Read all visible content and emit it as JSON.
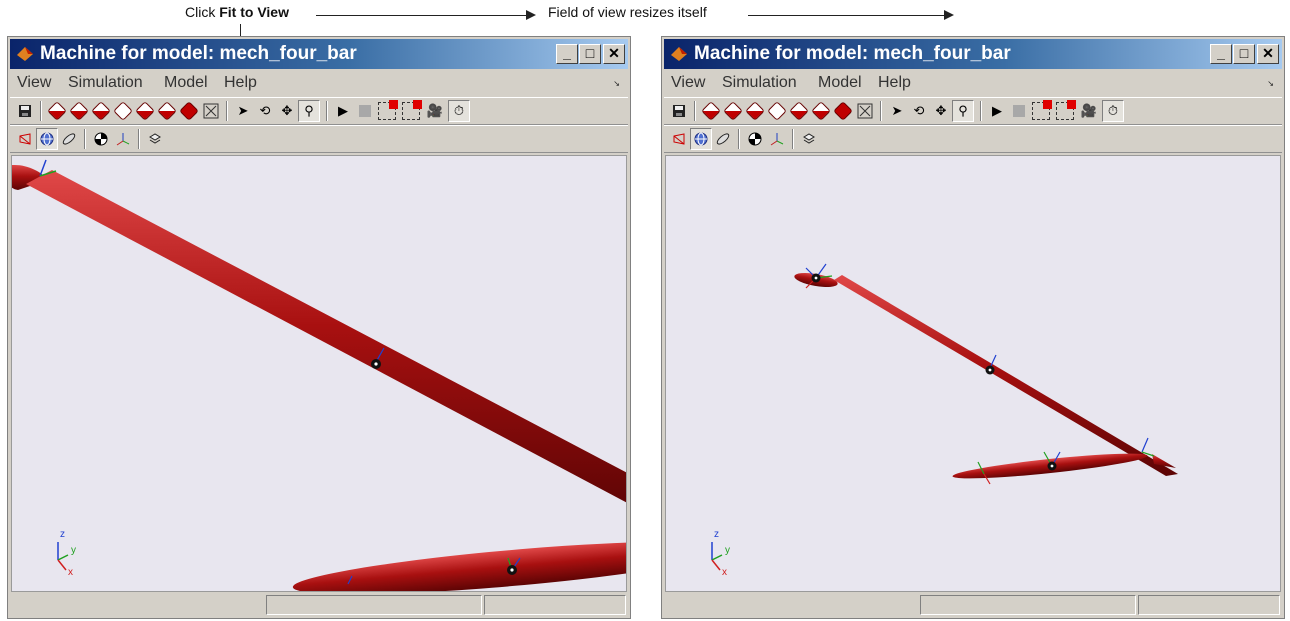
{
  "annotations": {
    "click_prefix": "Click ",
    "click_bold": "Fit to View",
    "field_text": "Field of view resizes itself"
  },
  "windows": [
    {
      "title": "Machine for model: mech_four_bar",
      "state": "before fit to view",
      "menu": [
        "View",
        "Simulation",
        "Model",
        "Help"
      ],
      "buttons": {
        "minimize": "_",
        "maximize": "□",
        "close": "✕"
      },
      "axis_labels": {
        "z": "z",
        "y": "y",
        "x": "x"
      }
    },
    {
      "title": "Machine for model: mech_four_bar",
      "state": "after fit to view",
      "menu": [
        "View",
        "Simulation",
        "Model",
        "Help"
      ],
      "buttons": {
        "minimize": "_",
        "maximize": "□",
        "close": "✕"
      },
      "axis_labels": {
        "z": "z",
        "y": "y",
        "x": "x"
      }
    }
  ],
  "colors": {
    "title_gradient": [
      "#0a246a",
      "#a6caf0"
    ],
    "body_red": "#a01010",
    "viewport_bg": "#e8e6ef",
    "chrome": "#d4d0c8"
  },
  "toolbar1_icons": [
    "save-icon",
    "view-front-icon",
    "view-back-icon",
    "view-left-icon",
    "view-right-icon",
    "view-top-icon",
    "view-bottom-icon",
    "view-iso-icon",
    "fit-to-view-icon",
    "select-icon",
    "rotate-icon",
    "pan-icon",
    "zoom-box-icon",
    "play-icon",
    "stop-icon",
    "record-icon",
    "record-settings-icon",
    "camera-icon",
    "timer-icon"
  ],
  "toolbar2_icons": [
    "wireframe-icon",
    "globe-icon",
    "ellipsoid-icon",
    "cg-icon",
    "axes-icon",
    "layers-icon"
  ]
}
